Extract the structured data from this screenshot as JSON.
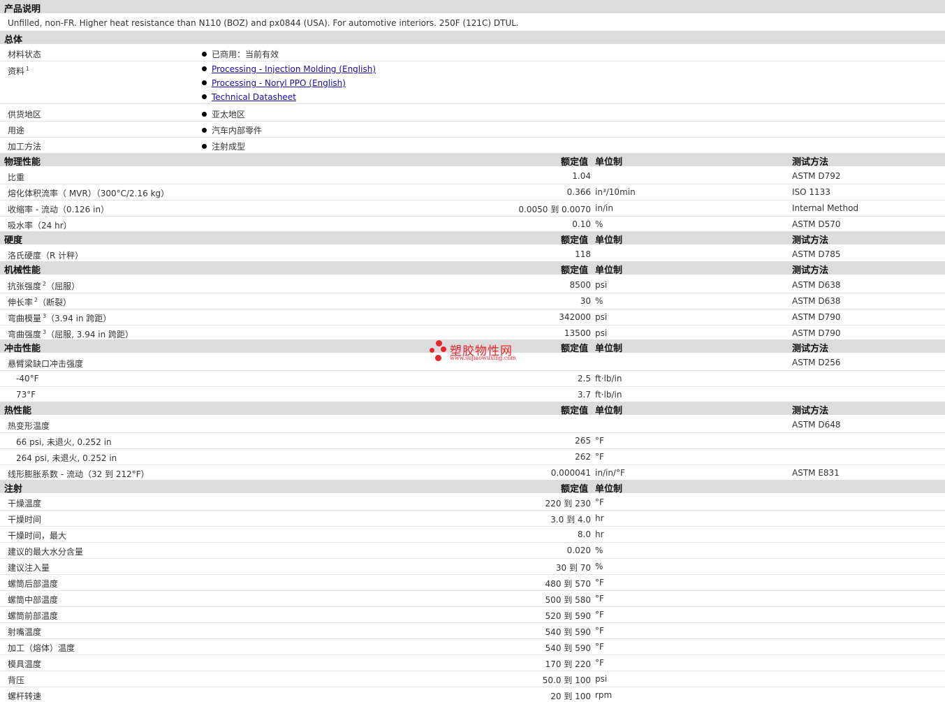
{
  "sections": {
    "product_desc": "产品说明",
    "general": "总体",
    "physical": "物理性能",
    "hardness": "硬度",
    "mechanical": "机械性能",
    "impact": "冲击性能",
    "thermal": "热性能",
    "injection": "注射"
  },
  "headers": {
    "value": "额定值",
    "unit": "单位制",
    "method": "测试方法"
  },
  "description": "Unfilled, non-FR. Higher heat resistance than N110 (BOZ) and px0844 (USA). For automotive interiors. 250F (121C) DTUL.",
  "general": {
    "material_status_label": "材料状态",
    "material_status_value": "已商用：当前有效",
    "documents_label": "资料",
    "documents_sup": "1",
    "documents": [
      "Processing - Injection Molding (English)",
      "Processing - Noryl PPO (English)",
      "Technical Datasheet"
    ],
    "supply_label": "供货地区",
    "supply_value": "亚太地区",
    "use_label": "用途",
    "use_value": "汽车内部零件",
    "process_label": "加工方法",
    "process_value": "注射成型"
  },
  "physical": [
    {
      "label": "比重",
      "value": "1.04",
      "unit": "",
      "method": "ASTM D792"
    },
    {
      "label": "熔化体积流率（ MVR）（300°C/2.16 kg）",
      "value": "0.366",
      "unit": "in³/10min",
      "method": "ISO 1133"
    },
    {
      "label": "收缩率 - 流动（0.126 in）",
      "value": "0.0050 到  0.0070",
      "unit": "in/in",
      "method": "Internal Method"
    },
    {
      "label": "吸水率（24 hr）",
      "value": "0.10",
      "unit": "%",
      "method": "ASTM D570"
    }
  ],
  "hardness": [
    {
      "label": "洛氏硬度（R 计秤）",
      "value": "118",
      "unit": "",
      "method": "ASTM D785"
    }
  ],
  "mechanical": [
    {
      "label": "抗张强度",
      "sup": "2",
      "suffix": "（屈服）",
      "value": "8500",
      "unit": "psi",
      "method": "ASTM D638"
    },
    {
      "label": "伸长率",
      "sup": "2",
      "suffix": "（断裂）",
      "value": "30",
      "unit": "%",
      "method": "ASTM D638"
    },
    {
      "label": "弯曲模量",
      "sup": "3",
      "suffix": "（3.94 in 跨距）",
      "value": "342000",
      "unit": "psi",
      "method": "ASTM D790"
    },
    {
      "label": "弯曲强度",
      "sup": "3",
      "suffix": "（屈服, 3.94 in 跨距）",
      "value": "13500",
      "unit": "psi",
      "method": "ASTM D790"
    }
  ],
  "impact": {
    "label": "悬臂梁缺口冲击强度",
    "method": "ASTM D256",
    "rows": [
      {
        "label": "-40°F",
        "value": "2.5",
        "unit": "ft·lb/in"
      },
      {
        "label": "73°F",
        "value": "3.7",
        "unit": "ft·lb/in"
      }
    ]
  },
  "thermal": {
    "hdt_label": "热变形温度",
    "hdt_method": "ASTM D648",
    "hdt_rows": [
      {
        "label": "66 psi, 未退火, 0.252 in",
        "value": "265",
        "unit": "°F"
      },
      {
        "label": "264 psi, 未退火, 0.252 in",
        "value": "262",
        "unit": "°F"
      }
    ],
    "clte": {
      "label": "线形膨胀系数 - 流动（32 到  212°F）",
      "value": "0.000041",
      "unit": "in/in/°F",
      "method": "ASTM E831"
    }
  },
  "injection": [
    {
      "label": "干燥温度",
      "value": "220 到  230",
      "unit": "°F"
    },
    {
      "label": "干燥时间",
      "value": "3.0 到  4.0",
      "unit": "hr"
    },
    {
      "label": "干燥时间，最大",
      "value": "8.0",
      "unit": "hr"
    },
    {
      "label": "建议的最大水分含量",
      "value": "0.020",
      "unit": "%"
    },
    {
      "label": "建议注入量",
      "value": "30 到  70",
      "unit": "%"
    },
    {
      "label": "螺筒后部温度",
      "value": "480 到  570",
      "unit": "°F"
    },
    {
      "label": "螺筒中部温度",
      "value": "500 到  580",
      "unit": "°F"
    },
    {
      "label": "螺筒前部温度",
      "value": "520 到  590",
      "unit": "°F"
    },
    {
      "label": "射嘴温度",
      "value": "540 到  590",
      "unit": "°F"
    },
    {
      "label": "加工（熔体）温度",
      "value": "540 到  590",
      "unit": "°F"
    },
    {
      "label": "模具温度",
      "value": "170 到  220",
      "unit": "°F"
    },
    {
      "label": "背压",
      "value": "50.0 到  100",
      "unit": "psi"
    },
    {
      "label": "螺杆转速",
      "value": "20 到  100",
      "unit": "rpm"
    }
  ],
  "watermark": {
    "text": "塑胶物性网",
    "url": "www.sujiaowuxing.com",
    "color": "#e8242c"
  }
}
